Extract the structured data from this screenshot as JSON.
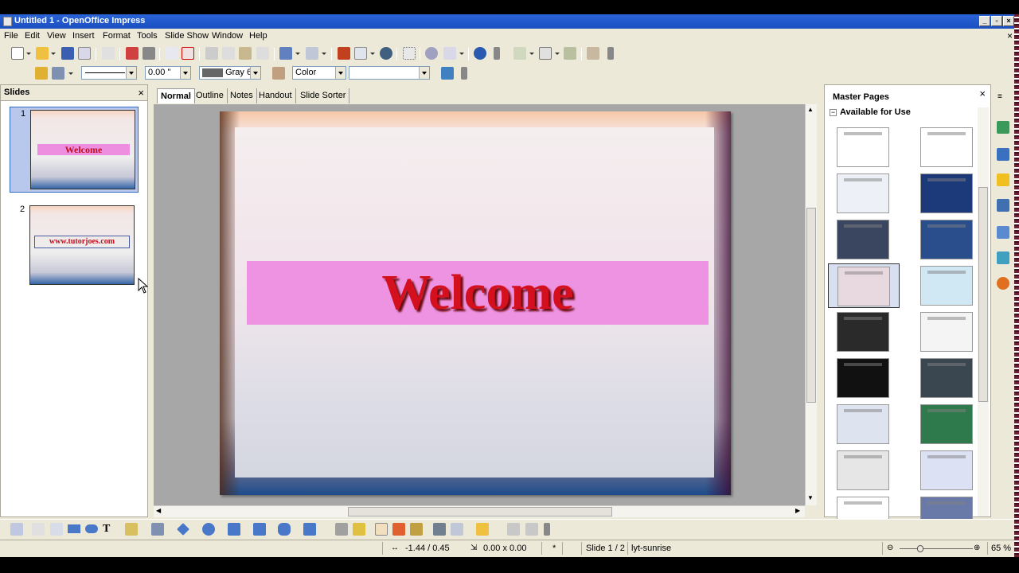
{
  "window": {
    "title": "Untitled 1 - OpenOffice Impress",
    "minimize": "_",
    "restore": "▫",
    "close": "×"
  },
  "menu": [
    "File",
    "Edit",
    "View",
    "Insert",
    "Format",
    "Tools",
    "Slide Show",
    "Window",
    "Help"
  ],
  "menu_close": "×",
  "line_toolbar": {
    "width_value": "0.00 \"",
    "fill_color": "Gray 6",
    "area_style": "Color",
    "area_fill": ""
  },
  "slides_pane": {
    "title": "Slides",
    "close": "×",
    "slides": [
      {
        "number": "1",
        "text": "Welcome"
      },
      {
        "number": "2",
        "text": "www.tutorjoes.com"
      }
    ]
  },
  "view_tabs": [
    "Normal",
    "Outline",
    "Notes",
    "Handout",
    "Slide Sorter"
  ],
  "active_tab": "Normal",
  "slide": {
    "title": "Welcome"
  },
  "master_pages": {
    "title": "Master Pages",
    "close": "×",
    "section": "Available for Use",
    "section_toggle": "−",
    "thumbs": [
      {
        "bg": "#ffffff"
      },
      {
        "bg": "#ffffff"
      },
      {
        "bg": "#eef0f8"
      },
      {
        "bg": "#1c3a7a"
      },
      {
        "bg": "#3a4660"
      },
      {
        "bg": "#2a4e8c"
      },
      {
        "bg": "#e8d8e0"
      },
      {
        "bg": "#d0e8f4"
      },
      {
        "bg": "#2a2a2a"
      },
      {
        "bg": "#f4f4f4"
      },
      {
        "bg": "#111111"
      },
      {
        "bg": "#3a4650"
      },
      {
        "bg": "#dde4f0"
      },
      {
        "bg": "#2e7a4c"
      },
      {
        "bg": "#e6e6e6"
      },
      {
        "bg": "#dce2f4"
      },
      {
        "bg": "#ffffff"
      },
      {
        "bg": "#6a7aa8"
      }
    ],
    "selected_index": 6
  },
  "status": {
    "position": "-1.44 / 0.45",
    "size": "0.00 x 0.00",
    "modified": "*",
    "slide": "Slide 1 / 2",
    "layout": "lyt-sunrise",
    "zoom": "65 %"
  },
  "colors": {
    "title_text": "#d4101e",
    "title_box": "#ed8ee0",
    "selection": "#316ac5"
  }
}
